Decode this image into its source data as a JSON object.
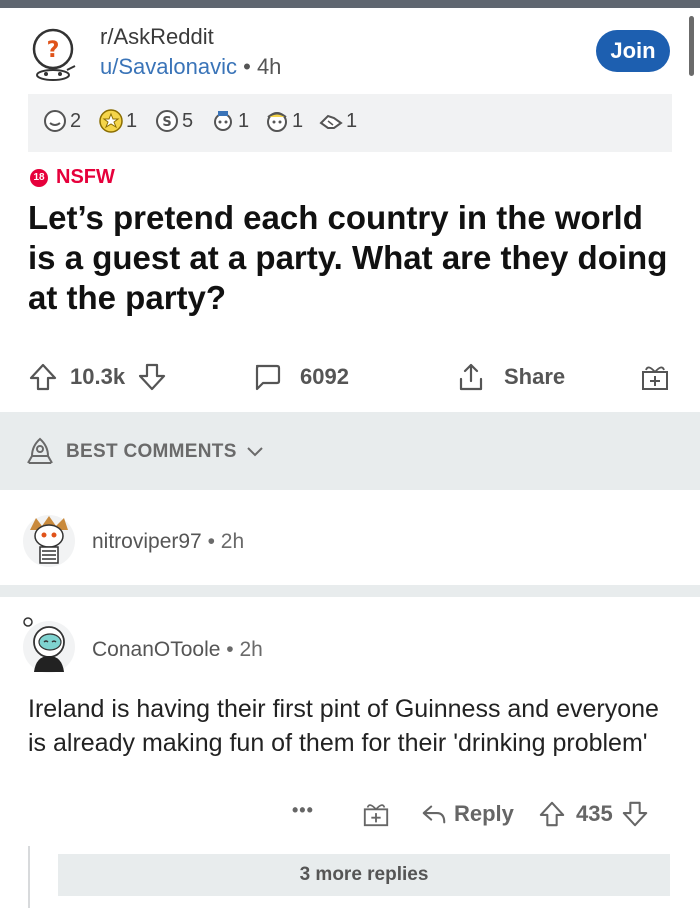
{
  "post": {
    "subreddit": "r/AskReddit",
    "user": "u/Savalonavic",
    "separator": "•",
    "age": "4h",
    "join_label": "Join",
    "awards": [
      {
        "icon": "wholesome-award-icon",
        "count": "2"
      },
      {
        "icon": "gold-award-icon",
        "count": "1"
      },
      {
        "icon": "silver-coin-award-icon",
        "count": "5"
      },
      {
        "icon": "helpful-award-icon",
        "count": "1"
      },
      {
        "icon": "pirate-award-icon",
        "count": "1"
      },
      {
        "icon": "handshake-award-icon",
        "count": "1"
      }
    ],
    "nsfw_badge": "18",
    "nsfw_label": "NSFW",
    "title": "Let’s pretend each country in the world is a guest at a party. What are they doing at the party?",
    "score": "10.3k",
    "comments_count": "6092",
    "share_label": "Share"
  },
  "sort": {
    "label": "BEST COMMENTS"
  },
  "comments": [
    {
      "user": "nitroviper97",
      "separator": "•",
      "age": "2h"
    },
    {
      "user": "ConanOToole",
      "separator": "•",
      "age": "2h",
      "body": "Ireland is having their first pint of Guinness and everyone is already making fun of them for their 'drinking problem'",
      "more_label": "•••",
      "reply_label": "Reply",
      "score": "435",
      "more_replies": "3 more replies"
    }
  ],
  "colors": {
    "accent": "#1d5fb0",
    "nsfw": "#e6003b",
    "link": "#3a74b8"
  }
}
